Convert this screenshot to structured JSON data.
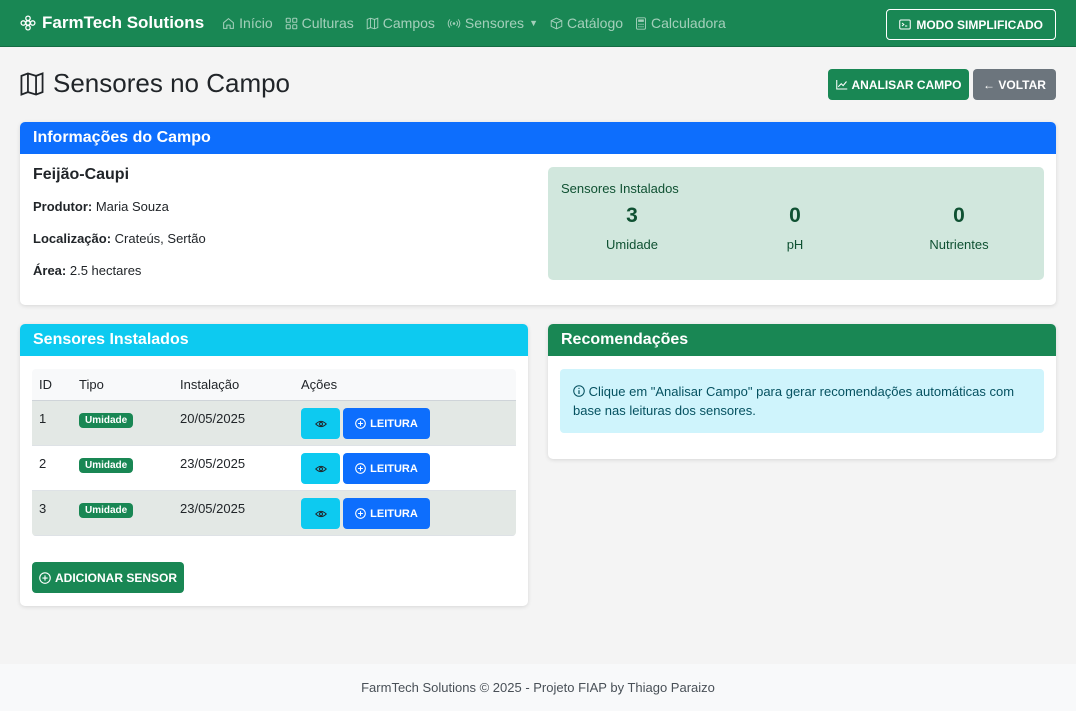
{
  "navbar": {
    "brand": "FarmTech Solutions",
    "items": [
      {
        "label": "Início",
        "icon": "house-icon"
      },
      {
        "label": "Culturas",
        "icon": "grid-icon"
      },
      {
        "label": "Campos",
        "icon": "map-icon"
      },
      {
        "label": "Sensores",
        "icon": "broadcast-icon"
      },
      {
        "label": "Catálogo",
        "icon": "box-icon"
      },
      {
        "label": "Calculadora",
        "icon": "calculator-icon"
      }
    ],
    "mode_button": "MODO SIMPLIFICADO"
  },
  "header": {
    "title": "Sensores no Campo",
    "analyze_button": "ANALISAR CAMPO",
    "back_button": "← VOLTAR"
  },
  "field_info": {
    "card_title": "Informações do Campo",
    "crop": "Feijão-Caupi",
    "producer_label": "Produtor:",
    "producer": "Maria Souza",
    "location_label": "Localização:",
    "location": "Crateús, Sertão",
    "area_label": "Área:",
    "area": "2.5 hectares",
    "installed": {
      "title": "Sensores Instalados",
      "stats": [
        {
          "value": "3",
          "label": "Umidade"
        },
        {
          "value": "0",
          "label": "pH"
        },
        {
          "value": "0",
          "label": "Nutrientes"
        }
      ]
    }
  },
  "sensors": {
    "card_title": "Sensores Instalados",
    "columns": [
      "ID",
      "Tipo",
      "Instalação",
      "Ações"
    ],
    "rows": [
      {
        "id": "1",
        "type": "Umidade",
        "date": "20/05/2025",
        "read_label": "LEITURA"
      },
      {
        "id": "2",
        "type": "Umidade",
        "date": "23/05/2025",
        "read_label": "LEITURA"
      },
      {
        "id": "3",
        "type": "Umidade",
        "date": "23/05/2025",
        "read_label": "LEITURA"
      }
    ],
    "add_button": "ADICIONAR SENSOR"
  },
  "recommendations": {
    "card_title": "Recomendações",
    "message": "Clique em \"Analisar Campo\" para gerar recomendações automáticas com base nas leituras dos sensores."
  },
  "footer": {
    "text": "FarmTech Solutions © 2025 - Projeto FIAP by Thiago Paraizo"
  },
  "colors": {
    "success": "#198754",
    "primary": "#0d6efd",
    "info": "#0dcaf0",
    "secondary": "#6c757d"
  }
}
